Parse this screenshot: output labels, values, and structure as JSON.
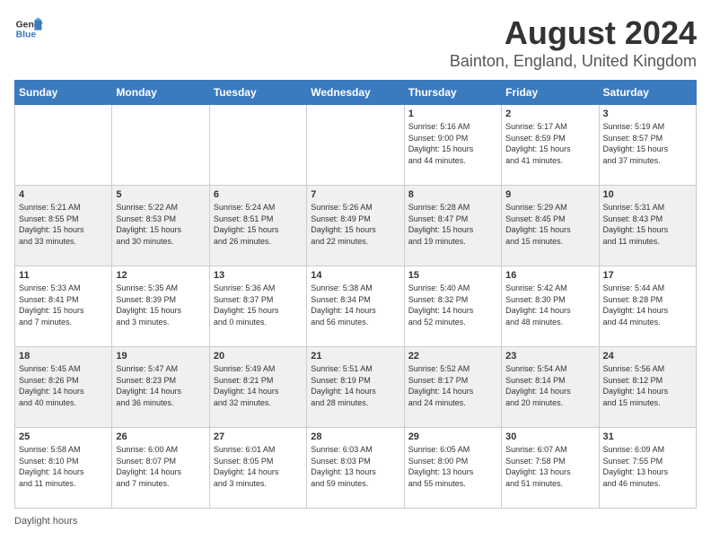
{
  "header": {
    "logo_general": "General",
    "logo_blue": "Blue",
    "main_title": "August 2024",
    "subtitle": "Bainton, England, United Kingdom"
  },
  "days_of_week": [
    "Sunday",
    "Monday",
    "Tuesday",
    "Wednesday",
    "Thursday",
    "Friday",
    "Saturday"
  ],
  "weeks": [
    [
      {
        "day": "",
        "info": ""
      },
      {
        "day": "",
        "info": ""
      },
      {
        "day": "",
        "info": ""
      },
      {
        "day": "",
        "info": ""
      },
      {
        "day": "1",
        "info": "Sunrise: 5:16 AM\nSunset: 9:00 PM\nDaylight: 15 hours\nand 44 minutes."
      },
      {
        "day": "2",
        "info": "Sunrise: 5:17 AM\nSunset: 8:59 PM\nDaylight: 15 hours\nand 41 minutes."
      },
      {
        "day": "3",
        "info": "Sunrise: 5:19 AM\nSunset: 8:57 PM\nDaylight: 15 hours\nand 37 minutes."
      }
    ],
    [
      {
        "day": "4",
        "info": "Sunrise: 5:21 AM\nSunset: 8:55 PM\nDaylight: 15 hours\nand 33 minutes."
      },
      {
        "day": "5",
        "info": "Sunrise: 5:22 AM\nSunset: 8:53 PM\nDaylight: 15 hours\nand 30 minutes."
      },
      {
        "day": "6",
        "info": "Sunrise: 5:24 AM\nSunset: 8:51 PM\nDaylight: 15 hours\nand 26 minutes."
      },
      {
        "day": "7",
        "info": "Sunrise: 5:26 AM\nSunset: 8:49 PM\nDaylight: 15 hours\nand 22 minutes."
      },
      {
        "day": "8",
        "info": "Sunrise: 5:28 AM\nSunset: 8:47 PM\nDaylight: 15 hours\nand 19 minutes."
      },
      {
        "day": "9",
        "info": "Sunrise: 5:29 AM\nSunset: 8:45 PM\nDaylight: 15 hours\nand 15 minutes."
      },
      {
        "day": "10",
        "info": "Sunrise: 5:31 AM\nSunset: 8:43 PM\nDaylight: 15 hours\nand 11 minutes."
      }
    ],
    [
      {
        "day": "11",
        "info": "Sunrise: 5:33 AM\nSunset: 8:41 PM\nDaylight: 15 hours\nand 7 minutes."
      },
      {
        "day": "12",
        "info": "Sunrise: 5:35 AM\nSunset: 8:39 PM\nDaylight: 15 hours\nand 3 minutes."
      },
      {
        "day": "13",
        "info": "Sunrise: 5:36 AM\nSunset: 8:37 PM\nDaylight: 15 hours\nand 0 minutes."
      },
      {
        "day": "14",
        "info": "Sunrise: 5:38 AM\nSunset: 8:34 PM\nDaylight: 14 hours\nand 56 minutes."
      },
      {
        "day": "15",
        "info": "Sunrise: 5:40 AM\nSunset: 8:32 PM\nDaylight: 14 hours\nand 52 minutes."
      },
      {
        "day": "16",
        "info": "Sunrise: 5:42 AM\nSunset: 8:30 PM\nDaylight: 14 hours\nand 48 minutes."
      },
      {
        "day": "17",
        "info": "Sunrise: 5:44 AM\nSunset: 8:28 PM\nDaylight: 14 hours\nand 44 minutes."
      }
    ],
    [
      {
        "day": "18",
        "info": "Sunrise: 5:45 AM\nSunset: 8:26 PM\nDaylight: 14 hours\nand 40 minutes."
      },
      {
        "day": "19",
        "info": "Sunrise: 5:47 AM\nSunset: 8:23 PM\nDaylight: 14 hours\nand 36 minutes."
      },
      {
        "day": "20",
        "info": "Sunrise: 5:49 AM\nSunset: 8:21 PM\nDaylight: 14 hours\nand 32 minutes."
      },
      {
        "day": "21",
        "info": "Sunrise: 5:51 AM\nSunset: 8:19 PM\nDaylight: 14 hours\nand 28 minutes."
      },
      {
        "day": "22",
        "info": "Sunrise: 5:52 AM\nSunset: 8:17 PM\nDaylight: 14 hours\nand 24 minutes."
      },
      {
        "day": "23",
        "info": "Sunrise: 5:54 AM\nSunset: 8:14 PM\nDaylight: 14 hours\nand 20 minutes."
      },
      {
        "day": "24",
        "info": "Sunrise: 5:56 AM\nSunset: 8:12 PM\nDaylight: 14 hours\nand 15 minutes."
      }
    ],
    [
      {
        "day": "25",
        "info": "Sunrise: 5:58 AM\nSunset: 8:10 PM\nDaylight: 14 hours\nand 11 minutes."
      },
      {
        "day": "26",
        "info": "Sunrise: 6:00 AM\nSunset: 8:07 PM\nDaylight: 14 hours\nand 7 minutes."
      },
      {
        "day": "27",
        "info": "Sunrise: 6:01 AM\nSunset: 8:05 PM\nDaylight: 14 hours\nand 3 minutes."
      },
      {
        "day": "28",
        "info": "Sunrise: 6:03 AM\nSunset: 8:03 PM\nDaylight: 13 hours\nand 59 minutes."
      },
      {
        "day": "29",
        "info": "Sunrise: 6:05 AM\nSunset: 8:00 PM\nDaylight: 13 hours\nand 55 minutes."
      },
      {
        "day": "30",
        "info": "Sunrise: 6:07 AM\nSunset: 7:58 PM\nDaylight: 13 hours\nand 51 minutes."
      },
      {
        "day": "31",
        "info": "Sunrise: 6:09 AM\nSunset: 7:55 PM\nDaylight: 13 hours\nand 46 minutes."
      }
    ]
  ],
  "footer": {
    "daylight_hours_label": "Daylight hours"
  }
}
